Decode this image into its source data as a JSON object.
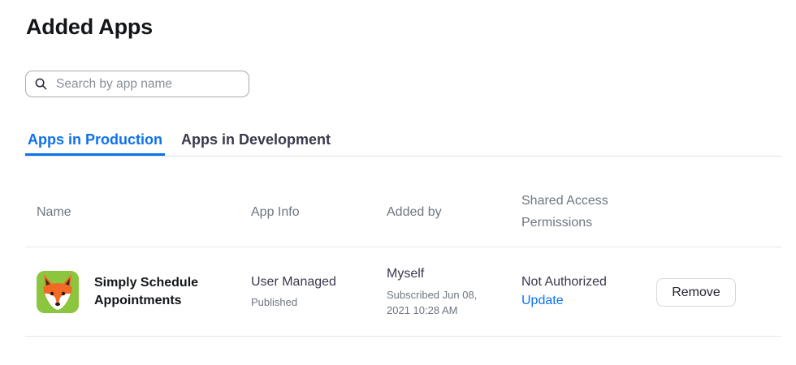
{
  "page": {
    "title": "Added Apps"
  },
  "search": {
    "placeholder": "Search by app name",
    "value": ""
  },
  "tabs": [
    {
      "label": "Apps in Production",
      "active": true
    },
    {
      "label": "Apps in Development",
      "active": false
    }
  ],
  "table": {
    "headers": {
      "name": "Name",
      "app_info": "App Info",
      "added_by": "Added by",
      "shared_access_line1": "Shared Access",
      "shared_access_line2": "Permissions"
    },
    "rows": [
      {
        "icon": "fox-app-icon",
        "name_line1": "Simply Schedule",
        "name_line2": "Appointments",
        "app_info": "User Managed",
        "app_status": "Published",
        "added_by": "Myself",
        "subscribed_line1": "Subscribed Jun 08,",
        "subscribed_line2": "2021 10:28 AM",
        "permission": "Not Authorized",
        "permission_action": "Update",
        "remove_label": "Remove"
      }
    ]
  },
  "colors": {
    "accent": "#0e72ed",
    "icon_bg": "#8cc63f",
    "fox_orange": "#f26a24"
  }
}
